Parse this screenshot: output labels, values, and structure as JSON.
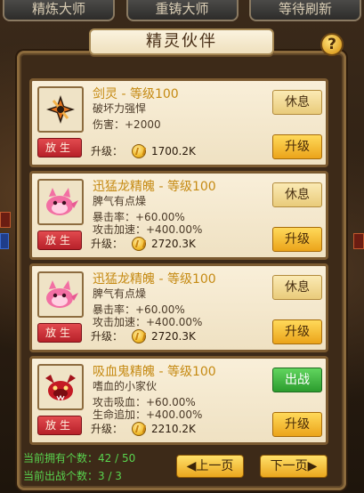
{
  "top_tabs": [
    "精炼大师",
    "重铸大师",
    "等待刷新"
  ],
  "panel": {
    "title": "精灵伙伴",
    "help_icon": "?"
  },
  "cards": [
    {
      "name": "剑灵 - 等级100",
      "desc": "破坏力强悍",
      "stats": [
        "伤害：+2000"
      ],
      "release_label": "放生",
      "upgrade_label": "升级：",
      "cost": "1700.2K",
      "action_label": "休息",
      "action_type": "rest",
      "upgrade_btn": "升级",
      "icon": "sword-spirit-icon"
    },
    {
      "name": "迅猛龙精魄 - 等级100",
      "desc": "脾气有点燥",
      "stats": [
        "暴击率：+60.00%",
        "攻击加速：+400.00%"
      ],
      "release_label": "放生",
      "upgrade_label": "升级：",
      "cost": "2720.3K",
      "action_label": "休息",
      "action_type": "rest",
      "upgrade_btn": "升级",
      "icon": "raptor-spirit-icon"
    },
    {
      "name": "迅猛龙精魄 - 等级100",
      "desc": "脾气有点燥",
      "stats": [
        "暴击率：+60.00%",
        "攻击加速：+400.00%"
      ],
      "release_label": "放生",
      "upgrade_label": "升级：",
      "cost": "2720.3K",
      "action_label": "休息",
      "action_type": "rest",
      "upgrade_btn": "升级",
      "icon": "raptor-spirit-icon"
    },
    {
      "name": "吸血鬼精魄 - 等级100",
      "desc": "嗜血的小家伙",
      "stats": [
        "攻击吸血：+60.00%",
        "生命追加：+400.00%"
      ],
      "release_label": "放生",
      "upgrade_label": "升级：",
      "cost": "2210.2K",
      "action_label": "出战",
      "action_type": "fight",
      "upgrade_btn": "升级",
      "icon": "vampire-spirit-icon"
    }
  ],
  "footer": {
    "owned": "当前拥有个数：42 / 50",
    "deployed": "当前出战个数：3 / 3",
    "prev_page": "◀上一页",
    "next_page": "下一页▶"
  },
  "colors": {
    "name": "#c58a13",
    "footer_green": "#59d34e",
    "release_red": "#c9333a",
    "fight_green": "#3eb33f"
  }
}
